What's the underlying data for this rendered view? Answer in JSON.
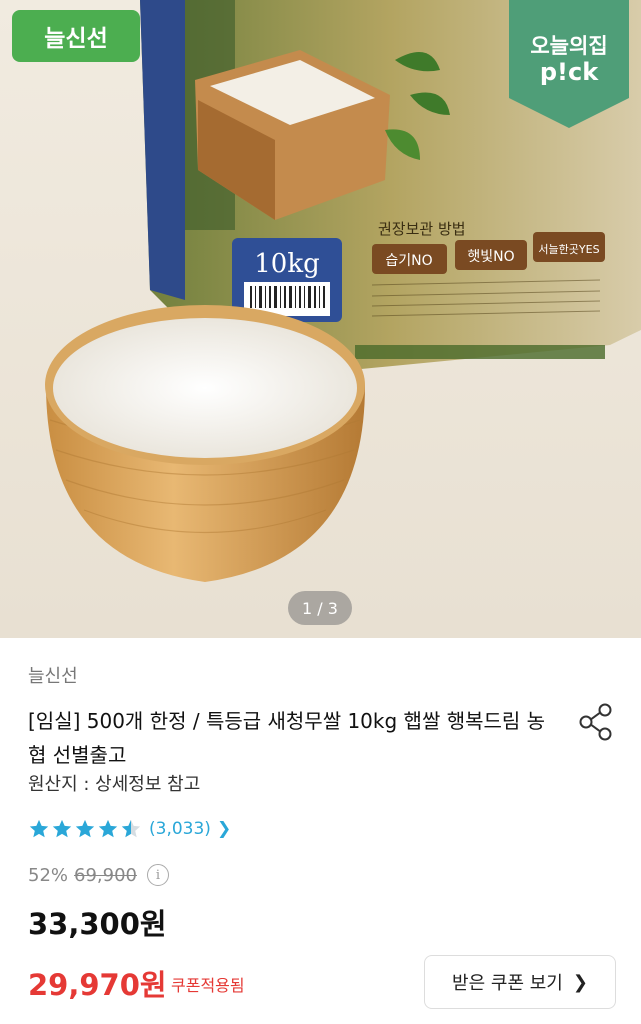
{
  "hero": {
    "badge_left": "늘신선",
    "badge_right_line1": "오늘의집",
    "badge_right_line2": "p!ck",
    "bag_weight": "10kg",
    "bag_storage_title": "권장보관 방법",
    "bag_tags": [
      "습기NO",
      "햇빛NO",
      "서늘한곳YES"
    ],
    "image_counter": "1 / 3"
  },
  "product": {
    "brand": "늘신선",
    "title": "[임실] 500개 한정 / 특등급 새청무쌀 10kg 햅쌀 행복드림 농협 선별출고",
    "origin": "원산지 : 상세정보 참고",
    "rating": 4.5,
    "review_count": "(3,033)",
    "discount": "52%",
    "original_price": "69,900",
    "price": "33,300원",
    "coupon_price": "29,970원",
    "coupon_tag": "쿠폰적용됨",
    "coupon_button": "받은 쿠폰 보기"
  },
  "colors": {
    "accent_green": "#4cae50",
    "review_blue": "#2aa7d8",
    "sale_red": "#e53935"
  },
  "icons": {
    "share": "share-icon",
    "info": "info-icon",
    "chevron": "chevron-right-icon"
  }
}
